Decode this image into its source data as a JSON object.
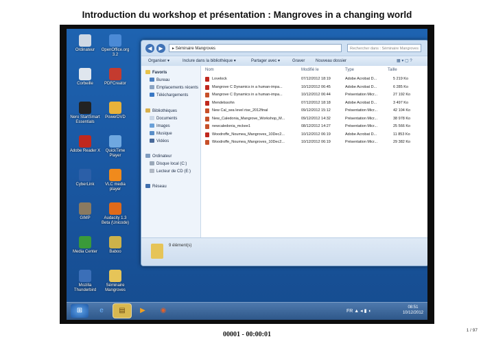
{
  "slide": {
    "title": "Introduction du workshop et présentation : Mangroves in a changing world",
    "footer": "00001 - 00:00:01",
    "page_number": "1 / 97"
  },
  "desktop_icons": [
    {
      "label": "Ordinateur",
      "color": "#cfd8e4"
    },
    {
      "label": "OpenOffice.org 3.2",
      "color": "#4b8ad6"
    },
    {
      "label": "Corbeille",
      "color": "#dfe6ee"
    },
    {
      "label": "PDFCreator",
      "color": "#c43b2f"
    },
    {
      "label": "Nero StartSmart Essentials",
      "color": "#222222"
    },
    {
      "label": "PowerDVD",
      "color": "#e8b23a"
    },
    {
      "label": "Adobe Reader X",
      "color": "#c0281e"
    },
    {
      "label": "QuickTime Player",
      "color": "#6fa8e0"
    },
    {
      "label": "CyberLink",
      "color": "#2b5fa8"
    },
    {
      "label": "VLC media player",
      "color": "#f08a1c"
    },
    {
      "label": "GIMP",
      "color": "#8a7a60"
    },
    {
      "label": "Audacity 1.3 Beta (Unicode)",
      "color": "#e06a1a"
    },
    {
      "label": "Media Center",
      "color": "#3a9a3a"
    },
    {
      "label": "Baboo",
      "color": "#ccb24a"
    },
    {
      "label": "Mozilla Thunderbird",
      "color": "#3b6fb8"
    },
    {
      "label": "Séminaire Mangroves",
      "color": "#e6c458"
    }
  ],
  "explorer": {
    "address": "Séminaire Mangroves",
    "search_placeholder": "Rechercher dans : Séminaire Mangroves",
    "toolbar": [
      "Organiser ▾",
      "Inclure dans la bibliothèque ▾",
      "Partager avec ▾",
      "Graver",
      "Nouveau dossier"
    ],
    "nav": {
      "favorites_header": "Favoris",
      "favorites": [
        "Bureau",
        "Emplacements récents",
        "Téléchargements"
      ],
      "libraries_header": "Bibliothèques",
      "libraries": [
        "Documents",
        "Images",
        "Musique",
        "Vidéos"
      ],
      "computer_header": "Ordinateur",
      "computer": [
        "Disque local (C:)",
        "Lecteur de CD (E:)"
      ],
      "network_header": "Réseau"
    },
    "columns": [
      "Nom",
      "Modifié le",
      "Type",
      "Taille"
    ],
    "files": [
      {
        "name": "Lovelock",
        "date": "07/12/2012 18:19",
        "type": "Adobe Acrobat D...",
        "size": "5 219 Ko",
        "kind": "pdf"
      },
      {
        "name": "Mangrove C Dynamics in a human-impa...",
        "date": "10/12/2012 06:45",
        "type": "Adobe Acrobat D...",
        "size": "6 285 Ko",
        "kind": "pdf"
      },
      {
        "name": "Mangrove C Dynamics in a human-impa...",
        "date": "10/12/2012 06:44",
        "type": "Présentation Micr...",
        "size": "27 192 Ko",
        "kind": "ppt"
      },
      {
        "name": "Mendelssohn",
        "date": "07/12/2012 18:18",
        "type": "Adobe Acrobat D...",
        "size": "3 497 Ko",
        "kind": "pdf"
      },
      {
        "name": "New Cal_sea level rise_2012final",
        "date": "09/12/2012 15:12",
        "type": "Présentation Micr...",
        "size": "42 104 Ko",
        "kind": "ppt"
      },
      {
        "name": "New_Caledonia_Mangrove_Workshop_M...",
        "date": "09/12/2012 14:32",
        "type": "Présentation Micr...",
        "size": "38 978 Ko",
        "kind": "ppt"
      },
      {
        "name": "newcaledonia_mckee1",
        "date": "08/12/2012 14:27",
        "type": "Présentation Micr...",
        "size": "25 566 Ko",
        "kind": "ppt"
      },
      {
        "name": "Woodroffe_Noumea_Mangroves_10Dec2...",
        "date": "10/12/2012 06:19",
        "type": "Adobe Acrobat D...",
        "size": "11 853 Ko",
        "kind": "pdf"
      },
      {
        "name": "Woodroffe_Noumea_Mangroves_10Dec2...",
        "date": "10/12/2012 06:19",
        "type": "Présentation Micr...",
        "size": "29 382 Ko",
        "kind": "ppt"
      }
    ],
    "status": "9 élément(s)"
  },
  "taskbar": {
    "start": "⊞",
    "buttons": [
      "e",
      "▤",
      "▶",
      "◉"
    ],
    "tray": "FR ▲ ◂ ▮ ◖",
    "time": "08:51",
    "date": "10/12/2012"
  },
  "colors": {
    "pdf": "#c0281e",
    "ppt": "#c7502a"
  }
}
